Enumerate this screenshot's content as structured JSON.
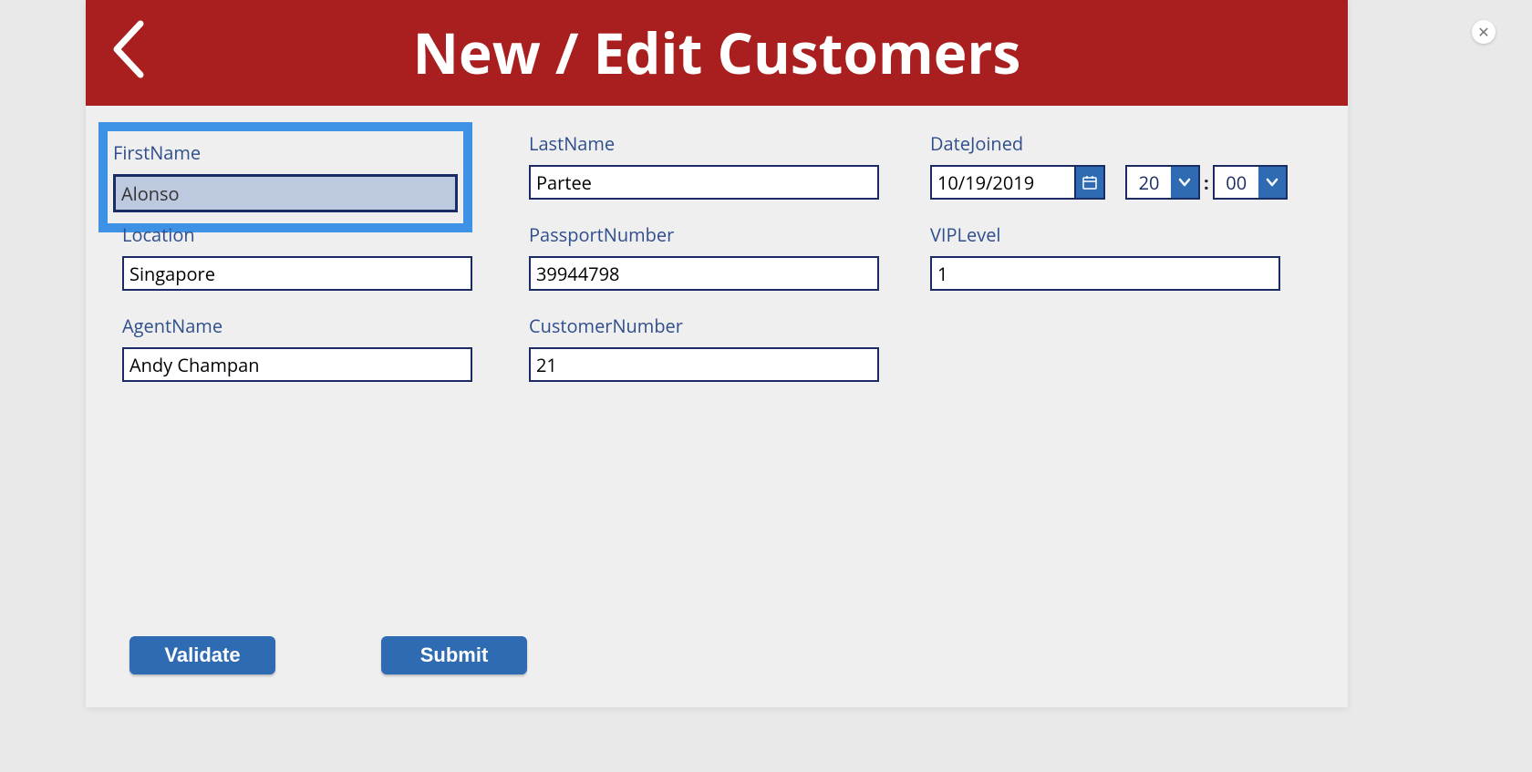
{
  "header": {
    "title": "New / Edit Customers"
  },
  "fields": {
    "firstName": {
      "label": "FirstName",
      "value": "Alonso"
    },
    "lastName": {
      "label": "LastName",
      "value": "Partee"
    },
    "dateJoined": {
      "label": "DateJoined",
      "date": "10/19/2019",
      "hour": "20",
      "minute": "00",
      "separator": ":"
    },
    "location": {
      "label": "Location",
      "value": "Singapore"
    },
    "passportNumber": {
      "label": "PassportNumber",
      "value": "39944798"
    },
    "vipLevel": {
      "label": "VIPLevel",
      "value": "1"
    },
    "agentName": {
      "label": "AgentName",
      "value": "Andy Champan"
    },
    "customerNumber": {
      "label": "CustomerNumber",
      "value": "21"
    }
  },
  "buttons": {
    "validate": "Validate",
    "submit": "Submit"
  },
  "closeGlyph": "✕"
}
